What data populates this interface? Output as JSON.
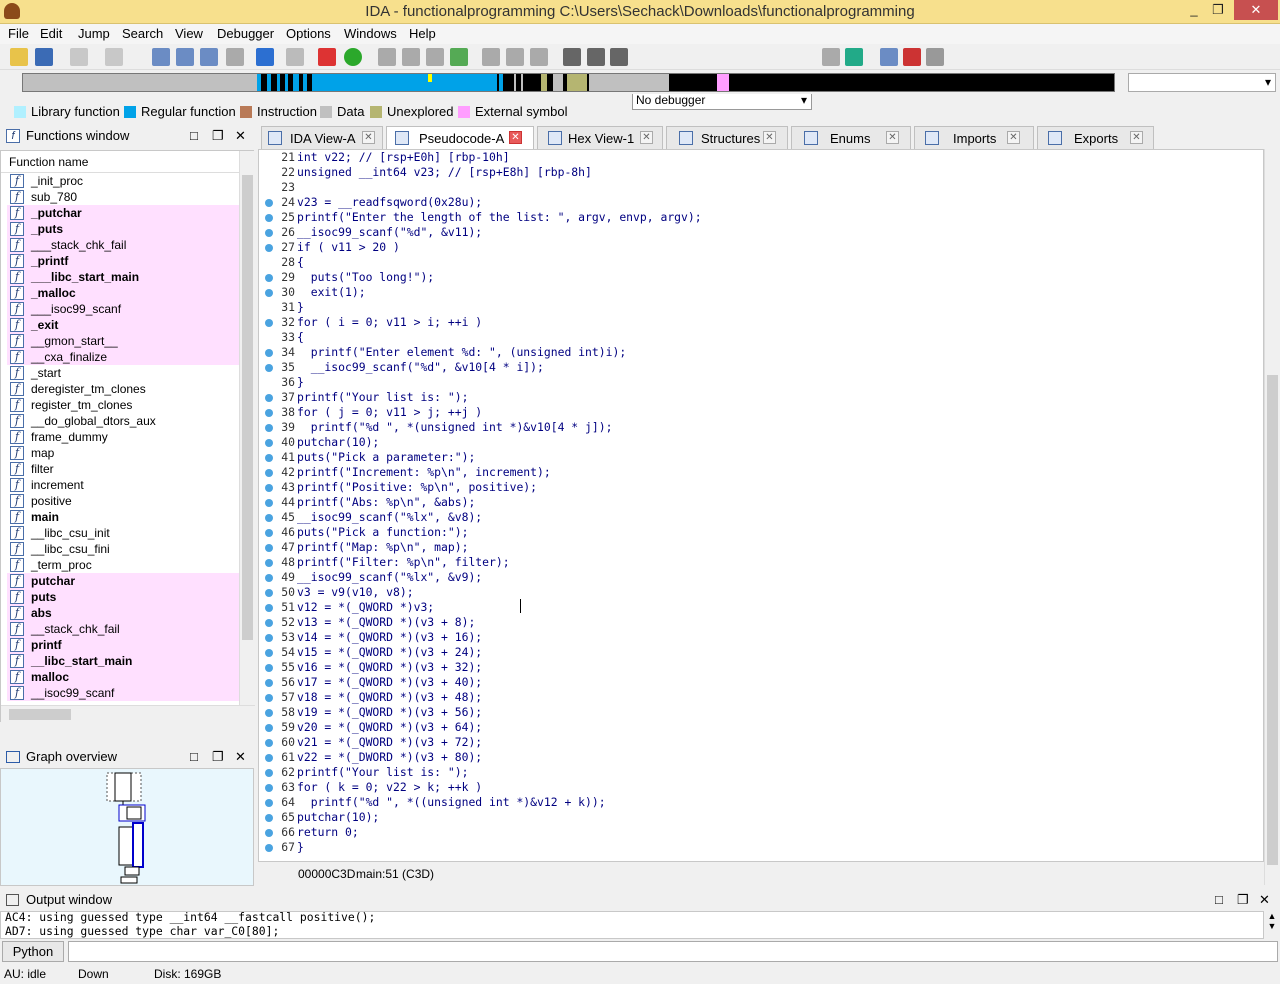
{
  "window": {
    "title": "IDA - functionalprogramming C:\\Users\\Sechack\\Downloads\\functionalprogramming",
    "minimize": "_",
    "maximize": "❐",
    "close": "✕"
  },
  "menu": [
    "File",
    "Edit",
    "Jump",
    "Search",
    "View",
    "Debugger",
    "Options",
    "Windows",
    "Help"
  ],
  "toolbar": {
    "debugger_select": "No debugger"
  },
  "legend": [
    {
      "label": "Library function",
      "color": "#b0f0ff"
    },
    {
      "label": "Regular function",
      "color": "#00a2e8"
    },
    {
      "label": "Instruction",
      "color": "#b97a57"
    },
    {
      "label": "Data",
      "color": "#c0c0c0"
    },
    {
      "label": "Unexplored",
      "color": "#b5b571"
    },
    {
      "label": "External symbol",
      "color": "#ff9eff"
    }
  ],
  "functions_window": {
    "title": "Functions window",
    "column": "Function name",
    "items": [
      {
        "name": "_init_proc",
        "ext": false,
        "bold": false
      },
      {
        "name": "sub_780",
        "ext": false,
        "bold": false
      },
      {
        "name": "_putchar",
        "ext": true,
        "bold": true
      },
      {
        "name": "_puts",
        "ext": true,
        "bold": true
      },
      {
        "name": "___stack_chk_fail",
        "ext": true,
        "bold": false
      },
      {
        "name": "_printf",
        "ext": true,
        "bold": true
      },
      {
        "name": "___libc_start_main",
        "ext": true,
        "bold": true
      },
      {
        "name": "_malloc",
        "ext": true,
        "bold": true
      },
      {
        "name": "___isoc99_scanf",
        "ext": true,
        "bold": false
      },
      {
        "name": "_exit",
        "ext": true,
        "bold": true
      },
      {
        "name": "__gmon_start__",
        "ext": true,
        "bold": false
      },
      {
        "name": "__cxa_finalize",
        "ext": true,
        "bold": false
      },
      {
        "name": "_start",
        "ext": false,
        "bold": false
      },
      {
        "name": "deregister_tm_clones",
        "ext": false,
        "bold": false
      },
      {
        "name": "register_tm_clones",
        "ext": false,
        "bold": false
      },
      {
        "name": "__do_global_dtors_aux",
        "ext": false,
        "bold": false
      },
      {
        "name": "frame_dummy",
        "ext": false,
        "bold": false
      },
      {
        "name": "map",
        "ext": false,
        "bold": false
      },
      {
        "name": "filter",
        "ext": false,
        "bold": false
      },
      {
        "name": "increment",
        "ext": false,
        "bold": false
      },
      {
        "name": "positive",
        "ext": false,
        "bold": false
      },
      {
        "name": "main",
        "ext": false,
        "bold": true
      },
      {
        "name": "__libc_csu_init",
        "ext": false,
        "bold": false
      },
      {
        "name": "__libc_csu_fini",
        "ext": false,
        "bold": false
      },
      {
        "name": "_term_proc",
        "ext": false,
        "bold": false
      },
      {
        "name": "putchar",
        "ext": true,
        "bold": true
      },
      {
        "name": "puts",
        "ext": true,
        "bold": true
      },
      {
        "name": "abs",
        "ext": true,
        "bold": true
      },
      {
        "name": "__stack_chk_fail",
        "ext": true,
        "bold": false
      },
      {
        "name": "printf",
        "ext": true,
        "bold": true
      },
      {
        "name": "__libc_start_main",
        "ext": true,
        "bold": true
      },
      {
        "name": "malloc",
        "ext": true,
        "bold": true
      },
      {
        "name": "__isoc99_scanf",
        "ext": true,
        "bold": false
      }
    ]
  },
  "graph_overview": {
    "title": "Graph overview"
  },
  "tabs": [
    {
      "label": "IDA View-A",
      "active": false
    },
    {
      "label": "Pseudocode-A",
      "active": true
    },
    {
      "label": "Hex View-1",
      "active": false
    },
    {
      "label": "Structures",
      "active": false
    },
    {
      "label": "Enums",
      "active": false
    },
    {
      "label": "Imports",
      "active": false
    },
    {
      "label": "Exports",
      "active": false
    }
  ],
  "pseudocode": {
    "lines": [
      {
        "n": "21",
        "dot": false,
        "code": "int v22; // [rsp+E0h] [rbp-10h]"
      },
      {
        "n": "22",
        "dot": false,
        "code": "unsigned __int64 v23; // [rsp+E8h] [rbp-8h]"
      },
      {
        "n": "23",
        "dot": false,
        "code": ""
      },
      {
        "n": "24",
        "dot": true,
        "code": "v23 = __readfsqword(0x28u);"
      },
      {
        "n": "25",
        "dot": true,
        "code": "printf(\"Enter the length of the list: \", argv, envp, argv);"
      },
      {
        "n": "26",
        "dot": true,
        "code": "__isoc99_scanf(\"%d\", &v11);"
      },
      {
        "n": "27",
        "dot": true,
        "code": "if ( v11 > 20 )"
      },
      {
        "n": "28",
        "dot": false,
        "code": "{"
      },
      {
        "n": "29",
        "dot": true,
        "code": "  puts(\"Too long!\");"
      },
      {
        "n": "30",
        "dot": true,
        "code": "  exit(1);"
      },
      {
        "n": "31",
        "dot": false,
        "code": "}"
      },
      {
        "n": "32",
        "dot": true,
        "code": "for ( i = 0; v11 > i; ++i )"
      },
      {
        "n": "33",
        "dot": false,
        "code": "{"
      },
      {
        "n": "34",
        "dot": true,
        "code": "  printf(\"Enter element %d: \", (unsigned int)i);"
      },
      {
        "n": "35",
        "dot": true,
        "code": "  __isoc99_scanf(\"%d\", &v10[4 * i]);"
      },
      {
        "n": "36",
        "dot": false,
        "code": "}"
      },
      {
        "n": "37",
        "dot": true,
        "code": "printf(\"Your list is: \");"
      },
      {
        "n": "38",
        "dot": true,
        "code": "for ( j = 0; v11 > j; ++j )"
      },
      {
        "n": "39",
        "dot": true,
        "code": "  printf(\"%d \", *(unsigned int *)&v10[4 * j]);"
      },
      {
        "n": "40",
        "dot": true,
        "code": "putchar(10);"
      },
      {
        "n": "41",
        "dot": true,
        "code": "puts(\"Pick a parameter:\");"
      },
      {
        "n": "42",
        "dot": true,
        "code": "printf(\"Increment: %p\\n\", increment);"
      },
      {
        "n": "43",
        "dot": true,
        "code": "printf(\"Positive: %p\\n\", positive);"
      },
      {
        "n": "44",
        "dot": true,
        "code": "printf(\"Abs: %p\\n\", &abs);"
      },
      {
        "n": "45",
        "dot": true,
        "code": "__isoc99_scanf(\"%lx\", &v8);"
      },
      {
        "n": "46",
        "dot": true,
        "code": "puts(\"Pick a function:\");"
      },
      {
        "n": "47",
        "dot": true,
        "code": "printf(\"Map: %p\\n\", map);"
      },
      {
        "n": "48",
        "dot": true,
        "code": "printf(\"Filter: %p\\n\", filter);"
      },
      {
        "n": "49",
        "dot": true,
        "code": "__isoc99_scanf(\"%lx\", &v9);"
      },
      {
        "n": "50",
        "dot": true,
        "code": "v3 = v9(v10, v8);"
      },
      {
        "n": "51",
        "dot": true,
        "code": "v12 = *(_QWORD *)v3;"
      },
      {
        "n": "52",
        "dot": true,
        "code": "v13 = *(_QWORD *)(v3 + 8);"
      },
      {
        "n": "53",
        "dot": true,
        "code": "v14 = *(_QWORD *)(v3 + 16);"
      },
      {
        "n": "54",
        "dot": true,
        "code": "v15 = *(_QWORD *)(v3 + 24);"
      },
      {
        "n": "55",
        "dot": true,
        "code": "v16 = *(_QWORD *)(v3 + 32);"
      },
      {
        "n": "56",
        "dot": true,
        "code": "v17 = *(_QWORD *)(v3 + 40);"
      },
      {
        "n": "57",
        "dot": true,
        "code": "v18 = *(_QWORD *)(v3 + 48);"
      },
      {
        "n": "58",
        "dot": true,
        "code": "v19 = *(_QWORD *)(v3 + 56);"
      },
      {
        "n": "59",
        "dot": true,
        "code": "v20 = *(_QWORD *)(v3 + 64);"
      },
      {
        "n": "60",
        "dot": true,
        "code": "v21 = *(_QWORD *)(v3 + 72);"
      },
      {
        "n": "61",
        "dot": true,
        "code": "v22 = *(_DWORD *)(v3 + 80);"
      },
      {
        "n": "62",
        "dot": true,
        "code": "printf(\"Your list is: \");"
      },
      {
        "n": "63",
        "dot": true,
        "code": "for ( k = 0; v22 > k; ++k )"
      },
      {
        "n": "64",
        "dot": true,
        "code": "  printf(\"%d \", *((unsigned int *)&v12 + k));"
      },
      {
        "n": "65",
        "dot": true,
        "code": "putchar(10);"
      },
      {
        "n": "66",
        "dot": true,
        "code": "return 0;"
      },
      {
        "n": "67",
        "dot": true,
        "code": "}"
      }
    ],
    "status_address": "00000C3D",
    "status_location": "main:51 (C3D)"
  },
  "output_window": {
    "title": "Output window",
    "lines": [
      "AC4: using guessed type __int64 __fastcall positive();",
      "AD7: using guessed type char var_C0[80];"
    ]
  },
  "python_button": "Python",
  "statusbar": {
    "au": "AU:  idle",
    "dir": "Down",
    "disk": "Disk: 169GB"
  }
}
